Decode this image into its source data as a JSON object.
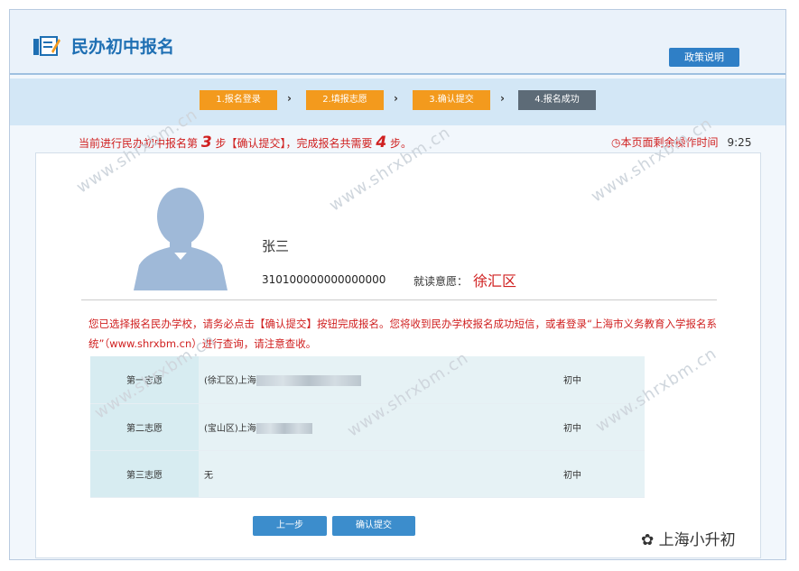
{
  "header": {
    "title": "民办初中报名",
    "policy_label": "政策说明"
  },
  "steps": [
    {
      "label": "1.报名登录"
    },
    {
      "label": "2.填报志愿"
    },
    {
      "label": "3.确认提交"
    },
    {
      "label": "4.报名成功"
    }
  ],
  "arrow": "›",
  "progress": {
    "prefix": "当前进行民办初中报名第",
    "current": "3",
    "middle": "步【确认提交】，完成报名共需要",
    "total": "4",
    "suffix": "步。"
  },
  "timer": {
    "label": "本页面剩余操作时间",
    "value": "9:25"
  },
  "student": {
    "name": "张三",
    "id": "310100000000000000",
    "district_label": "就读意愿：",
    "district": "徐汇区"
  },
  "notice": "您已选择报名民办学校，请务必点击【确认提交】按钮完成报名。您将收到民办学校报名成功短信，或者登录“上海市义务教育入学报名系统”（www.shrxbm.cn）进行查询，请注意查收。",
  "choices": [
    {
      "label": "第一志愿",
      "school": "(徐汇区)上海",
      "level": "初中"
    },
    {
      "label": "第二志愿",
      "school": "(宝山区)上海",
      "level": "初中"
    },
    {
      "label": "第三志愿",
      "school": "无",
      "level": "初中"
    }
  ],
  "buttons": {
    "prev": "上一步",
    "submit": "确认提交"
  },
  "watermark": "www.shrxbm.cn",
  "footer_brand": "上海小升初",
  "colors": {
    "brand_blue": "#1e6fb3",
    "step_active": "#f39a1d",
    "step_inactive": "#5d6b77",
    "alert_red": "#d02020"
  }
}
